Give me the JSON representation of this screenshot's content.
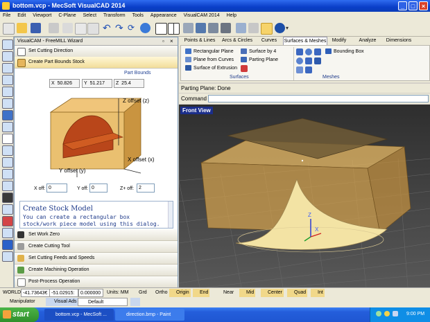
{
  "window": {
    "title": "bottom.vcp - MecSoft VisualCAD 2014",
    "controls": [
      "_",
      "□",
      "×"
    ]
  },
  "menu": [
    "File",
    "Edit",
    "Viewport",
    "C-Plane",
    "Select",
    "Transform",
    "Tools",
    "Appearance",
    "VisualCAM 2014",
    "Help"
  ],
  "panel": {
    "header": "VisualCAM - FreeMILL Wizard",
    "steps_top": [
      "Set Cutting Direction",
      "Create Part Bounds Stock"
    ],
    "part_bounds_label": "Part Bounds",
    "bounds": {
      "x_label": "X",
      "x": "50.826",
      "y_label": "Y",
      "y": "51.217",
      "z_label": "Z",
      "z": "25.4"
    },
    "diagram_labels": {
      "z_offset": "Z offset (z)",
      "x_offset": "X offset (x)",
      "y_offset": "Y offset (y)"
    },
    "offsets": {
      "x_label": "X off:",
      "x": "0",
      "y_label": "Y off:",
      "y": "0",
      "z_label": "Z+ off:",
      "z": "2"
    },
    "help_title": "Create Stock Model",
    "help_text": "You can create a rectangular box stock/work piece model using this dialog.  The extents of this",
    "steps_bottom": [
      "Set Work Zero",
      "Create Cutting Tool",
      "Set Cutting Feeds and Speeds",
      "Create Machining Operation",
      "Post-Process Operation"
    ]
  },
  "ribbon": {
    "tabs": [
      "Points & Lines",
      "Arcs & Circles",
      "Curves",
      "Surfaces & Meshes",
      "Modify",
      "Analyze",
      "Dimensions"
    ],
    "surfaces_cmds": [
      "Rectangular Plane",
      "Plane from Curves",
      "Surface of Extrusion",
      "Surface by 4",
      "Parting Plane"
    ],
    "meshes_cmds": [
      "Bounding Box"
    ],
    "group_surfaces": "Surfaces",
    "group_meshes": "Meshes"
  },
  "parting_status": "Parting Plane: Done",
  "command_label": "Command",
  "view_label": "Front View",
  "status": {
    "world": "WORLD",
    "x": "-41.73643€",
    "y": "-51.02915:",
    "z": "0.000000",
    "units": "Units: MM",
    "snaps": [
      "Grd",
      "Ortho",
      "Origin",
      "End",
      "Near",
      "Mid",
      "Center",
      "Quad",
      "Int"
    ]
  },
  "bottombar": {
    "manipulator": "Manipulator",
    "visual_ads": "Visual Ads",
    "layer": "Default"
  },
  "taskbar": {
    "start": "start",
    "tasks": [
      "bottom.vcp - MecSoft ...",
      "direction.bmp - Paint"
    ],
    "time": "9:00 PM"
  },
  "colors": {
    "stock": "#e8b961",
    "part": "#f2e2a0",
    "accent": "#245edb"
  }
}
